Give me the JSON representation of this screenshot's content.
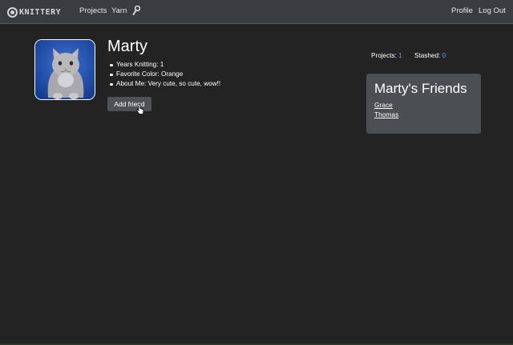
{
  "navbar": {
    "brand": "KNITTERY",
    "links": [
      "Projects",
      "Yarn"
    ],
    "tool_icon": "wrench-icon",
    "right_links": [
      "Profile",
      "Log Out"
    ]
  },
  "profile": {
    "name": "Marty",
    "avatar": "cat-photo",
    "details": [
      "Years Knitting: 1",
      "Favorite Color: Orange",
      "About Me: Very cute, so cute, wow!!"
    ],
    "add_friend_label": "Add friend"
  },
  "stats": {
    "projects_label": "Projects:",
    "projects_value": "1",
    "stashed_label": "Stashed:",
    "stashed_value": "0"
  },
  "friends": {
    "title": "Marty's Friends",
    "list": [
      "Grace",
      "Thomas"
    ]
  },
  "colors": {
    "background": "#232323",
    "navbar": "#3a3c40",
    "card": "#4b4e53",
    "stat_value": "#6f98d8"
  }
}
